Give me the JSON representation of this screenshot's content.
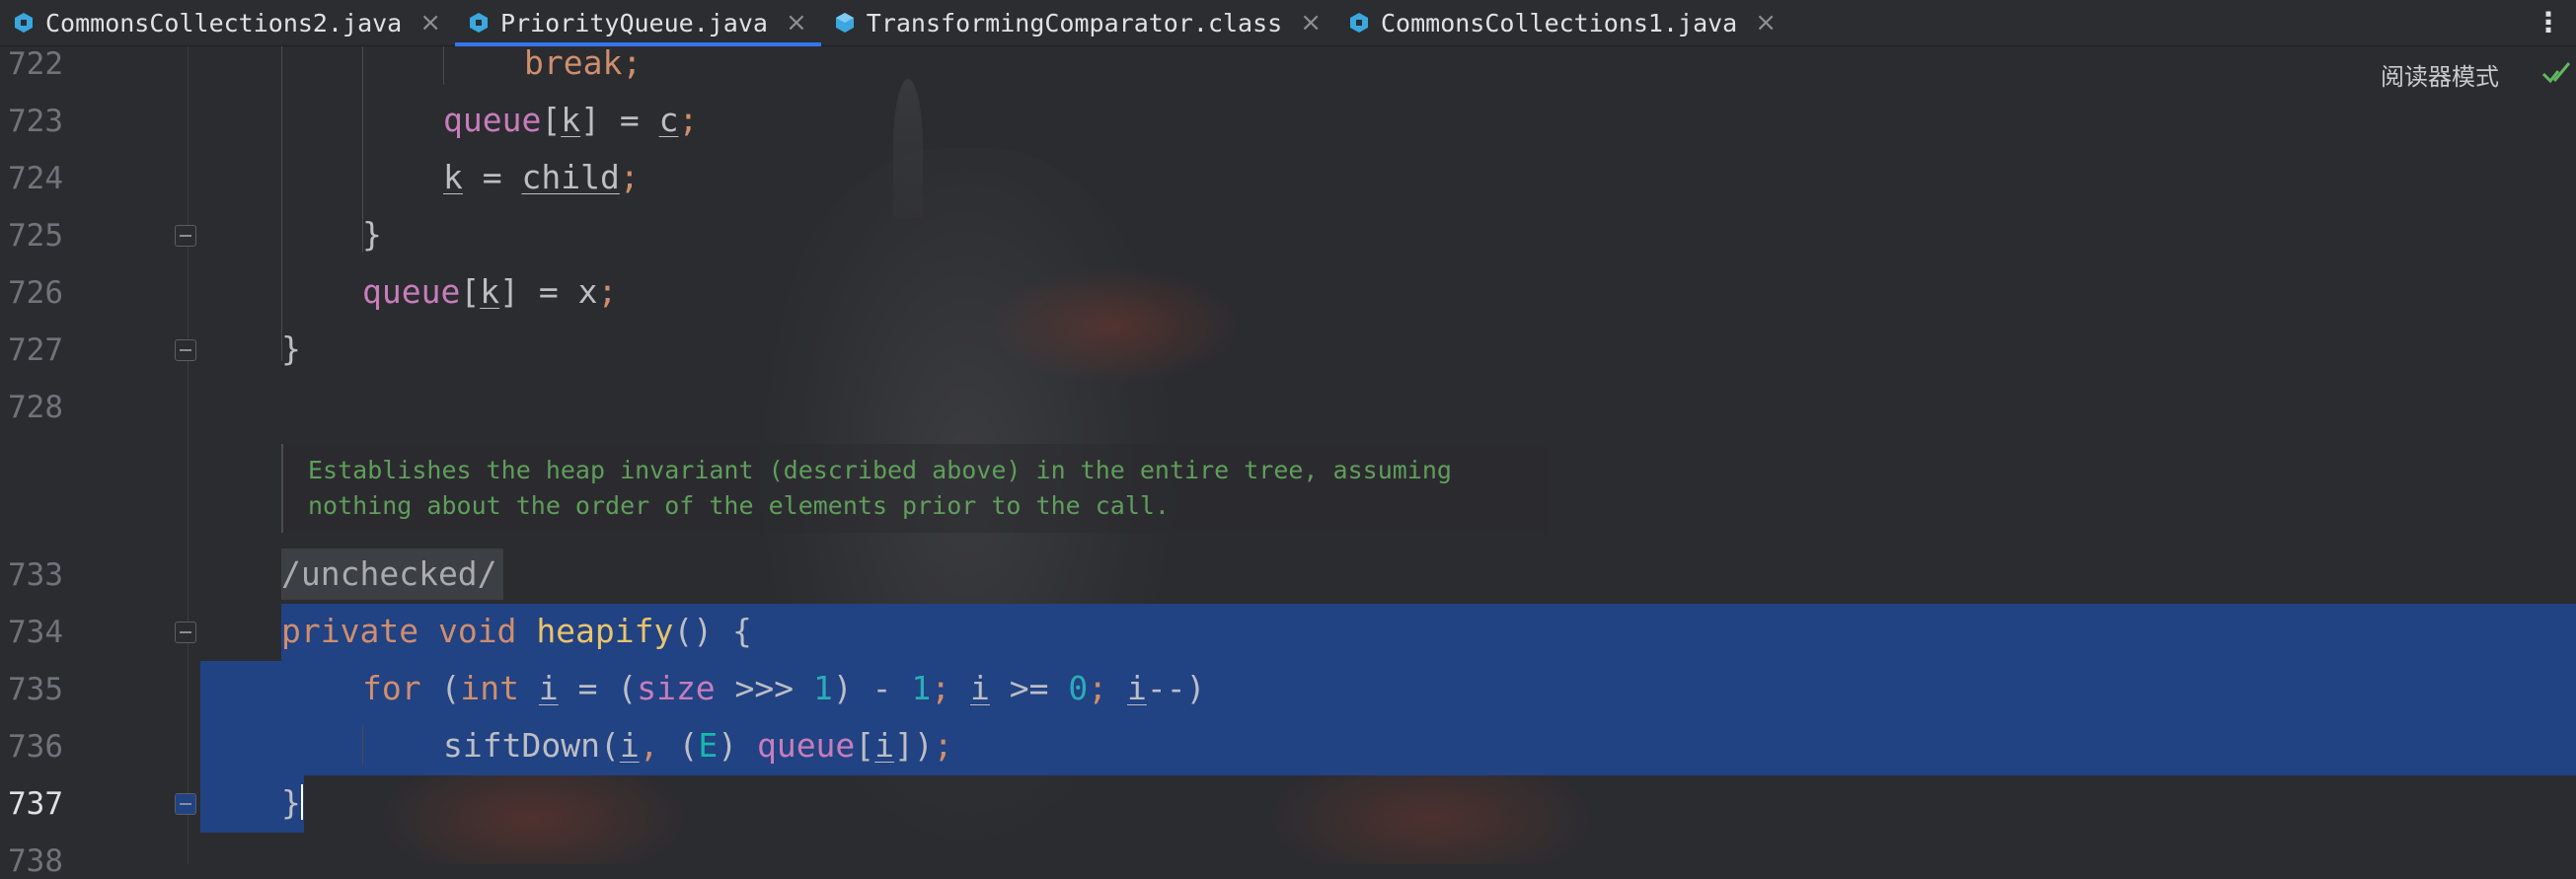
{
  "tabs": [
    {
      "label": "CommonsCollections2.java",
      "icon": "java-file-icon",
      "active": false
    },
    {
      "label": "PriorityQueue.java",
      "icon": "java-file-icon",
      "active": true
    },
    {
      "label": "TransformingComparator.class",
      "icon": "class-file-icon",
      "active": false
    },
    {
      "label": "CommonsCollections1.java",
      "icon": "java-file-icon",
      "active": false
    }
  ],
  "close_glyph": "×",
  "menu_glyph": "⋮",
  "reader_mode_label": "阅读器模式",
  "line_numbers": [
    "722",
    "723",
    "724",
    "725",
    "726",
    "727",
    "728",
    "733",
    "734",
    "735",
    "736",
    "737",
    "738"
  ],
  "doc_comment": [
    "Establishes the heap invariant (described above) in the entire tree, assuming",
    "nothing about the order of the elements prior to the call."
  ],
  "code": {
    "l722": {
      "kw": "break",
      "semi": ";"
    },
    "l723": {
      "field": "queue",
      "lb": "[",
      "var": "k",
      "rest": "] = ",
      "val": "c",
      "semi": ";"
    },
    "l724": {
      "var": "k",
      "eq": " = ",
      "val": "child",
      "semi": ";"
    },
    "l725": {
      "brace": "}"
    },
    "l726": {
      "field": "queue",
      "lb": "[",
      "var": "k",
      "rest": "] = x",
      "semi": ";"
    },
    "l727": {
      "brace": "}"
    },
    "l733": {
      "annotation": "/unchecked/"
    },
    "l734": {
      "kw1": "private",
      "kw2": "void",
      "method": "heapify",
      "rest": "() {"
    },
    "l735": {
      "kw_for": "for",
      "p1": " (",
      "kw_int": "int",
      "sp": " ",
      "var_i": "i",
      "p2": " = (",
      "field_size": "size",
      "op1": " >>> ",
      "n1": "1",
      "p3": ") - ",
      "n2": "1",
      "semi1": ";",
      "sp2": " ",
      "var_i2": "i",
      "op2": " >= ",
      "n0": "0",
      "semi2": ";",
      "sp3": " ",
      "var_i3": "i",
      "tail": "--)"
    },
    "l736": {
      "call": "siftDown",
      "p1": "(",
      "var_i": "i",
      "comma": ",",
      "p2": " (",
      "type": "E",
      "p3": ") ",
      "field": "queue",
      "lb": "[",
      "var_i2": "i",
      "p4": "])",
      "semi": ";"
    },
    "l737": {
      "brace": "}"
    }
  }
}
